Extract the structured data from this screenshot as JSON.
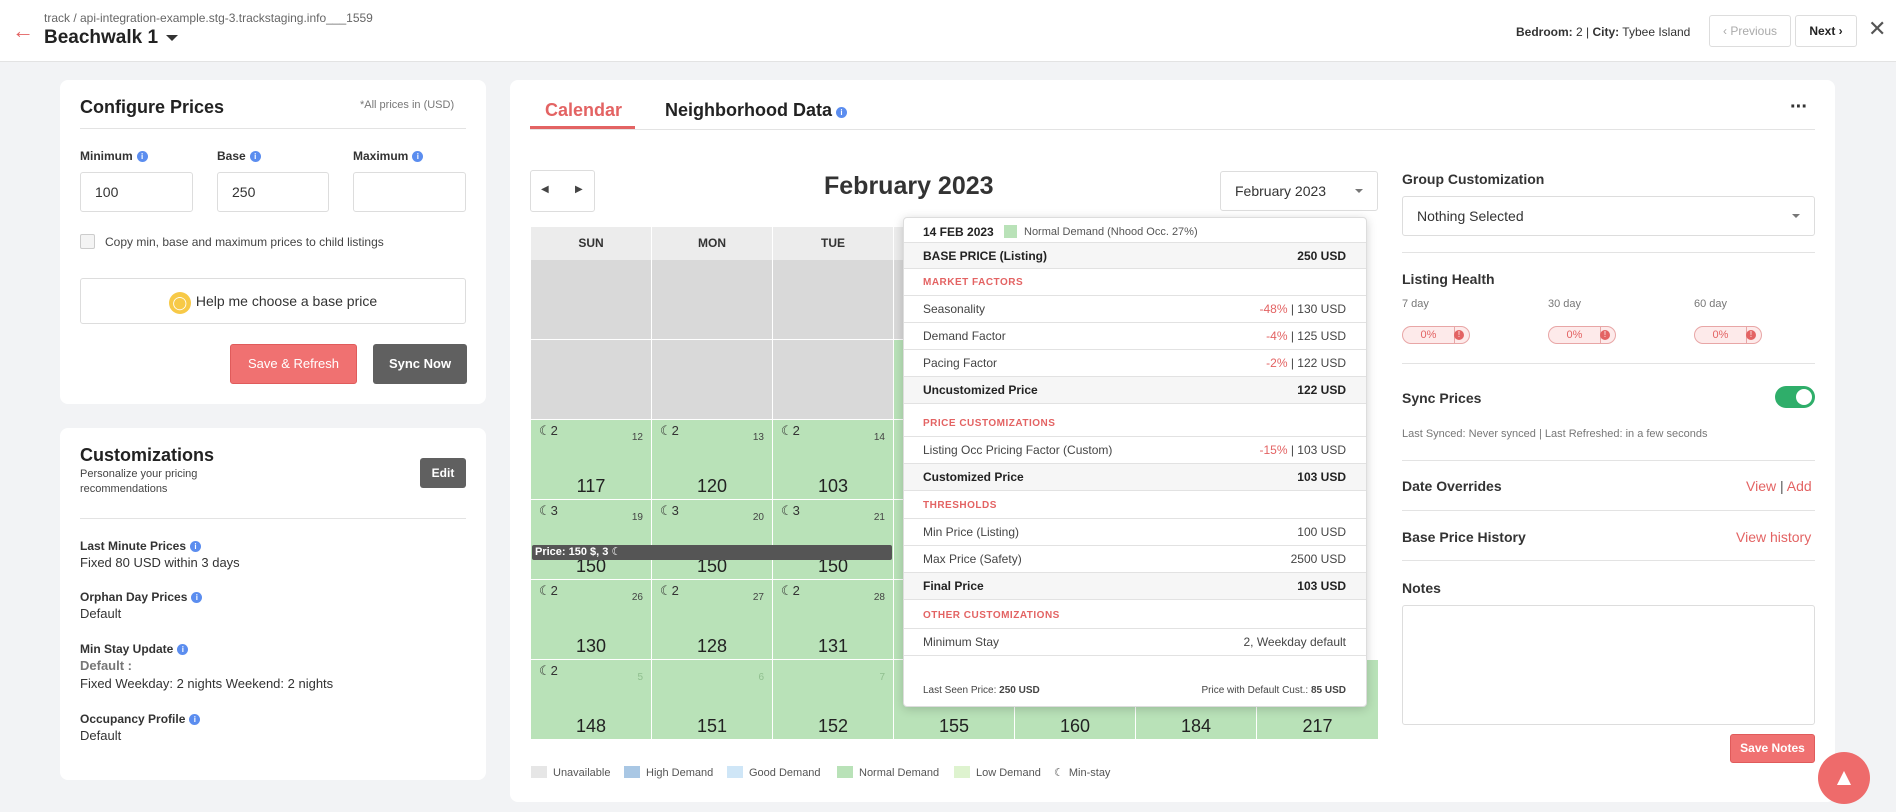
{
  "header": {
    "breadcrumb": "track / api-integration-example.stg-3.trackstaging.info___1559",
    "title": "Beachwalk 1",
    "bedroom_label": "Bedroom:",
    "bedroom_value": "2",
    "city_label": "City:",
    "city_value": "Tybee Island",
    "prev_label": "Previous",
    "next_label": "Next"
  },
  "configure": {
    "title": "Configure Prices",
    "note": "*All prices in (USD)",
    "min_label": "Minimum",
    "base_label": "Base",
    "max_label": "Maximum",
    "min_value": "100",
    "base_value": "250",
    "max_value": "",
    "copy_label": "Copy min, base and maximum prices to child listings",
    "help_label": "Help me choose a base price",
    "save_label": "Save & Refresh",
    "sync_label": "Sync Now"
  },
  "customizations": {
    "title": "Customizations",
    "subtitle_1": "Personalize your pricing",
    "subtitle_2": "recommendations",
    "edit_label": "Edit",
    "last_minute_label": "Last Minute Prices",
    "last_minute_value": "Fixed 80 USD within 3 days",
    "orphan_label": "Orphan Day Prices",
    "orphan_value": "Default",
    "minstay_label": "Min Stay Update",
    "minstay_default": "Default :",
    "minstay_value": "Fixed Weekday: 2 nights Weekend: 2 nights",
    "occupancy_label": "Occupancy Profile",
    "occupancy_value": "Default"
  },
  "tabs": {
    "calendar": "Calendar",
    "neighborhood": "Neighborhood Data"
  },
  "calendar": {
    "month_title": "February 2023",
    "month_select": "February 2023",
    "day_headers": [
      "SUN",
      "MON",
      "TUE"
    ],
    "price_tooltip": "Price: 150 $, 3",
    "rows": [
      [
        {
          "day": "12",
          "price": "117"
        },
        {
          "day": "13",
          "price": "120"
        },
        {
          "day": "14",
          "price": "103"
        }
      ],
      [
        {
          "day": "19",
          "price": "150"
        },
        {
          "day": "20",
          "price": "150"
        },
        {
          "day": "21",
          "price": "150"
        }
      ],
      [
        {
          "day": "26",
          "price": "130"
        },
        {
          "day": "27",
          "price": "128"
        },
        {
          "day": "28",
          "price": "131"
        }
      ],
      [
        {
          "day": "5",
          "price": "148"
        },
        {
          "day": "6",
          "price": "151"
        },
        {
          "day": "7",
          "price": "152"
        }
      ]
    ],
    "bottom_extra_prices": [
      "155",
      "160",
      "184",
      "217"
    ]
  },
  "popup": {
    "date": "14 FEB 2023",
    "demand": "Normal Demand (Nhood Occ. 27%)",
    "base_price_label": "BASE PRICE (Listing)",
    "base_price_value": "250 USD",
    "market_factors": "MARKET FACTORS",
    "seasonality_label": "Seasonality",
    "seasonality_pct": "-48%",
    "seasonality_value": " | 130 USD",
    "demand_label": "Demand Factor",
    "demand_pct": "-4%",
    "demand_value": " | 125 USD",
    "pacing_label": "Pacing Factor",
    "pacing_pct": "-2%",
    "pacing_value": " | 122 USD",
    "uncustomized_label": "Uncustomized Price",
    "uncustomized_value": "122 USD",
    "price_customizations": "PRICE CUSTOMIZATIONS",
    "occ_label": "Listing Occ Pricing Factor (Custom)",
    "occ_pct": "-15%",
    "occ_value": " | 103 USD",
    "customized_label": "Customized Price",
    "customized_value": "103 USD",
    "thresholds": "THRESHOLDS",
    "minprice_label": "Min Price (Listing)",
    "minprice_value": "100 USD",
    "maxprice_label": "Max Price (Safety)",
    "maxprice_value": "2500 USD",
    "final_label": "Final Price",
    "final_value": "103 USD",
    "other_customizations": "OTHER CUSTOMIZATIONS",
    "minstay_label": "Minimum Stay",
    "minstay_value": "2, Weekday default",
    "last_seen_label": "Last Seen Price:",
    "last_seen_value": "250 USD",
    "default_cust_label": "Price with Default Cust.:",
    "default_cust_value": "85 USD"
  },
  "legend": {
    "unavailable": "Unavailable",
    "high": "High Demand",
    "good": "Good Demand",
    "normal": "Normal Demand",
    "low": "Low Demand",
    "minstay": "Min-stay"
  },
  "colors": {
    "unavailable": "#e6e6e6",
    "high": "#a9c7e4",
    "good": "#cfe6f7",
    "normal": "#b9e2b8",
    "low": "#def3cf",
    "accent": "#e36363"
  },
  "right": {
    "group_label": "Group Customization",
    "group_value": "Nothing Selected",
    "health_label": "Listing Health",
    "h7_label": "7 day",
    "h30_label": "30 day",
    "h60_label": "60 day",
    "h7": "0%",
    "h30": "0%",
    "h60": "0%",
    "sync_label": "Sync Prices",
    "sync_on": true,
    "sync_status": "Last Synced: Never synced | Last Refreshed: in a few seconds",
    "overrides_label": "Date Overrides",
    "view_label": "View",
    "add_label": "Add",
    "history_label": "Base Price History",
    "history_link": "View history",
    "notes_label": "Notes",
    "save_notes": "Save Notes"
  }
}
